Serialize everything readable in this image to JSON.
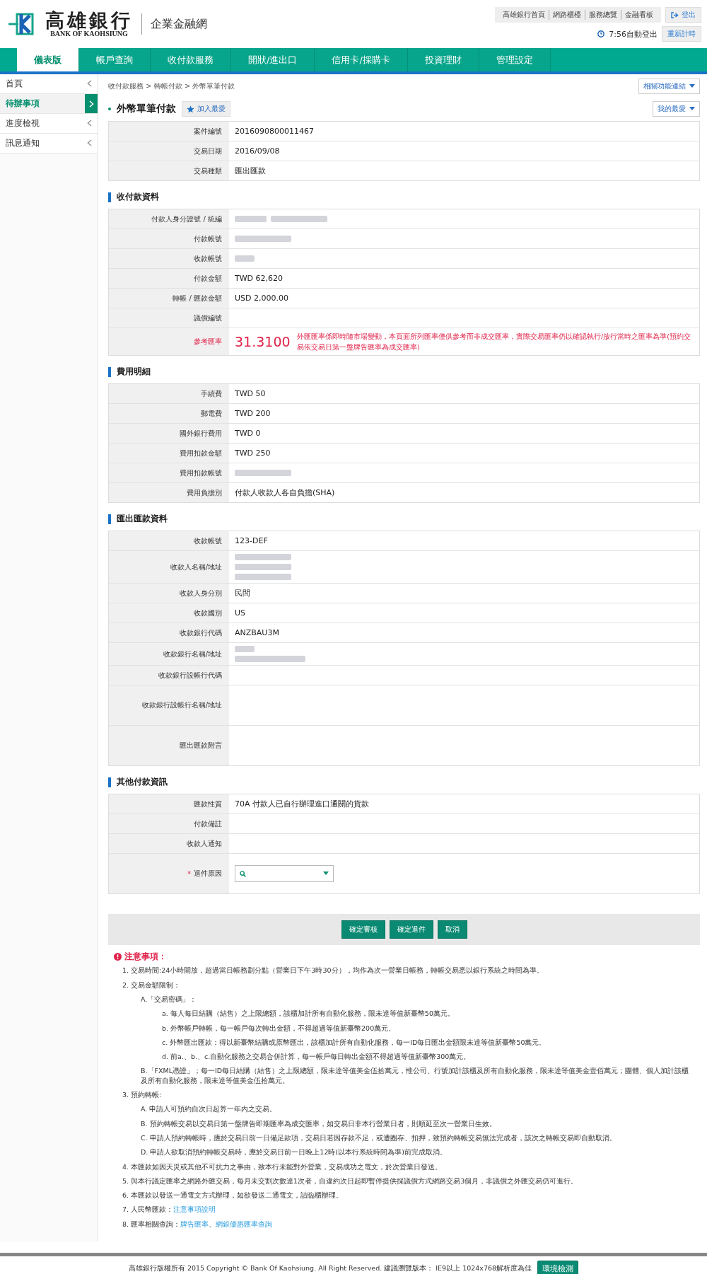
{
  "header": {
    "bank_name": "高雄銀行",
    "bank_name_en": "BANK OF KAOHSIUNG",
    "site_name": "企業金融網",
    "top_links": [
      "高雄銀行首頁",
      "網路櫃檯",
      "服務總覽",
      "金融看板"
    ],
    "logout": "登出",
    "timer": "7:56自動登出",
    "reset_timer": "重新計時"
  },
  "nav": [
    {
      "label": "儀表版",
      "selected": true
    },
    {
      "label": "帳戶查詢",
      "selected": false
    },
    {
      "label": "收付款服務",
      "selected": false
    },
    {
      "label": "開狀/進出口",
      "selected": false
    },
    {
      "label": "信用卡/採購卡",
      "selected": false
    },
    {
      "label": "投資理財",
      "selected": false
    },
    {
      "label": "管理設定",
      "selected": false
    }
  ],
  "sidebar": [
    {
      "label": "首頁",
      "selected": false
    },
    {
      "label": "待辦事項",
      "selected": true
    },
    {
      "label": "進度檢視",
      "selected": false
    },
    {
      "label": "訊息通知",
      "selected": false
    }
  ],
  "breadcrumb": "收付款服務 > 轉帳付款 > 外幣單筆付款",
  "related_links": "相關功能連結",
  "favorites": "我的最愛",
  "page_title": "外幣單筆付款",
  "add_favorite": "加入最愛",
  "summary": [
    {
      "kind": "text",
      "label": "案件編號",
      "value": "2016090800011467"
    },
    {
      "kind": "text",
      "label": "交易日期",
      "value": "2016/09/08"
    },
    {
      "kind": "text",
      "label": "交易種類",
      "value": "匯出匯款"
    }
  ],
  "sections": [
    {
      "title": "收付款資料",
      "rows": [
        {
          "kind": "redacted",
          "label": "付款人身分證號 / 統編",
          "blur": [
            [
              {
                "kind": "short"
              },
              {
                "kind": "medium"
              }
            ]
          ]
        },
        {
          "kind": "redacted",
          "label": "付款帳號",
          "blur": [
            [
              {
                "kind": "medium"
              }
            ]
          ]
        },
        {
          "kind": "redacted",
          "label": "收款帳號",
          "blur": [
            [
              {
                "kind": "tiny"
              }
            ]
          ]
        },
        {
          "kind": "text",
          "label": "付款金額",
          "value": "TWD 62,620"
        },
        {
          "kind": "text",
          "label": "轉帳 / 匯款金額",
          "value": "USD 2,000.00"
        },
        {
          "kind": "text",
          "label": "議價編號"
        },
        {
          "kind": "rate",
          "label": "參考匯率",
          "value": "31.3100",
          "note": "外匯匯率係即時隨市場變動，本頁面所列匯率僅供參考而非成交匯率，實際交易匯率仍以確認執行/放行當時之匯率為準(預約交易依交易日第一盤牌告匯率為成交匯率)"
        }
      ]
    },
    {
      "title": "費用明細",
      "rows": [
        {
          "kind": "text",
          "label": "手續費",
          "value": "TWD 50"
        },
        {
          "kind": "text",
          "label": "郵電費",
          "value": "TWD 200"
        },
        {
          "kind": "text",
          "label": "國外銀行費用",
          "value": "TWD 0"
        },
        {
          "kind": "text",
          "label": "費用扣款金額",
          "value": "TWD 250"
        },
        {
          "kind": "redacted",
          "label": "費用扣款帳號",
          "blur": [
            [
              {
                "kind": "medium"
              }
            ]
          ]
        },
        {
          "kind": "text",
          "label": "費用負擔別",
          "value": "付款人收款人各自負擔(SHA)"
        }
      ]
    },
    {
      "title": "匯出匯款資料",
      "rows": [
        {
          "kind": "text",
          "label": "收款帳號",
          "value": "123-DEF"
        },
        {
          "kind": "redacted",
          "label": "收款人名稱/地址",
          "blur": [
            [
              {
                "kind": "medium"
              }
            ],
            [
              {
                "kind": "medium"
              }
            ],
            [
              {
                "kind": "medium"
              }
            ]
          ]
        },
        {
          "kind": "text",
          "label": "收款人身分別",
          "value": "民間"
        },
        {
          "kind": "text",
          "label": "收款國別",
          "value": "US"
        },
        {
          "kind": "text",
          "label": "收款銀行代碼",
          "value": "ANZBAU3M"
        },
        {
          "kind": "redacted",
          "label": "收款銀行名稱/地址",
          "blur": [
            [
              {
                "kind": "tiny"
              }
            ],
            [
              {
                "kind": "long"
              }
            ]
          ]
        },
        {
          "kind": "text",
          "label": "收款銀行設帳行代碼"
        },
        {
          "kind": "tall",
          "label": "收款銀行設帳行名稱/地址"
        },
        {
          "kind": "tall",
          "label": "匯出匯款附言"
        }
      ]
    },
    {
      "title": "其他付款資訊",
      "rows": [
        {
          "kind": "text",
          "label": "匯款性質",
          "value": "70A 付款人已自行辦理進口通關的貨款"
        },
        {
          "kind": "text",
          "label": "付款備註"
        },
        {
          "kind": "text",
          "label": "收款人通知"
        },
        {
          "kind": "select",
          "label": "退件原因",
          "required": true,
          "required_mark": "*"
        }
      ]
    }
  ],
  "buttons": [
    "確定審核",
    "確定退件",
    "取消"
  ],
  "notes": {
    "title": "注意事項：",
    "items": [
      {
        "text": "1. 交易時間:24小時開放，超過當日帳務劃分點（營業日下午3時30分），均作為次一營業日帳務，轉帳交易悉以銀行系統之時間為準。"
      },
      {
        "text": "2. 交易金額限制：",
        "children": [
          {
            "text": "A.「交易密碼」：",
            "children": [
              {
                "text": "a. 每人每日結購（結售）之上限總額，該櫃加計所有自動化服務，限未達等值新臺幣50萬元。"
              },
              {
                "text": "b. 外幣帳戶轉帳，每一帳戶每次轉出金額，不得超過等值新臺幣200萬元。"
              },
              {
                "text": "c. 外幣匯出匯款：得以新臺幣結購或原幣匯出，該櫃加計所有自動化服務，每一ID每日匯出金額限未達等值新臺幣50萬元。"
              },
              {
                "text": "d. 前a.、b.、c.自動化服務之交易合併計算，每一帳戶每日轉出金額不得超過等值新臺幣300萬元。"
              }
            ]
          },
          {
            "text": "B.「FXML憑證」；每一ID每日結購（結售）之上限總額，限未達等值美金伍拾萬元，惟公司、行號加計該櫃及所有自動化服務，限未達等值美金壹佰萬元；團體、個人加計該櫃及所有自動化服務，限未達等值美金伍拾萬元。"
          }
        ]
      },
      {
        "text": "3. 預約轉帳:",
        "children": [
          {
            "text": "A. 申請人可預約自次日起算一年內之交易。"
          },
          {
            "text": "B. 預約轉帳交易以交易日第一盤牌告即期匯率為成交匯率，如交易日非本行營業日者，則順延至次一營業日生效。"
          },
          {
            "text": "C. 申請人預約轉帳時，應於交易日前一日備足款項，交易日若因存款不足，或遭圈存、扣押，致預約轉帳交易無法完成者，該次之轉帳交易即自動取消。"
          },
          {
            "text": "D. 申請人欲取消預約轉帳交易時，應於交易日前一日晚上12時(以本行系統時間為準)前完成取消。"
          }
        ]
      },
      {
        "text": "4. 本匯款如因天災或其他不可抗力之事由，致本行未能對外營業，交易成功之電文，於次營業日發送。"
      },
      {
        "text": "5. 與本行議定匯率之網路外匯交易，每月未交割次數達1次者，自違約次日起即暫停提供採議價方式網路交易3個月，非議價之外匯交易仍可進行。"
      },
      {
        "text": "6. 本匯款以發送一通電文方式辦理，如欲發送二通電文，請臨櫃辦理。"
      },
      {
        "text": "7. 人民幣匯款：",
        "links": [
          "注意事項說明"
        ]
      },
      {
        "text": "8. 匯率相關查詢：",
        "links": [
          "牌告匯率",
          "網銀優惠匯率查詢"
        ],
        "separator": "、"
      }
    ]
  },
  "footer": {
    "text": "高雄銀行版權所有 2015 Copyright © Bank Of Kaohsiung. All Right Reserved. 建議瀏覽版本： IE9以上 1024x768解析度為佳",
    "button": "環境檢測"
  }
}
